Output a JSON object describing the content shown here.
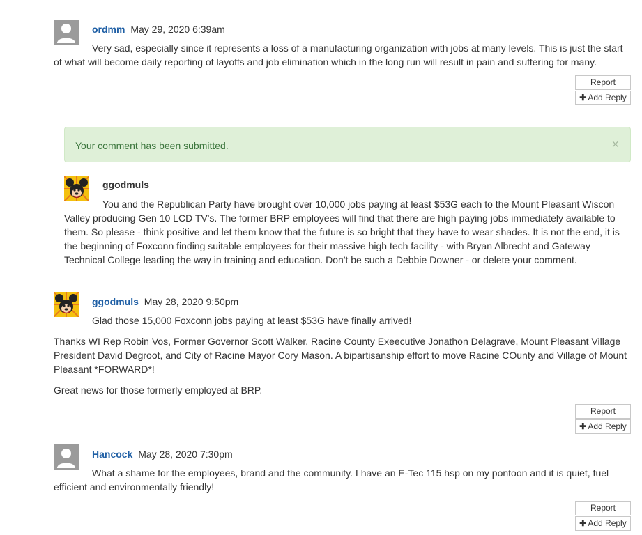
{
  "comments": [
    {
      "author": "ordmm",
      "date": "May 29, 2020 6:39am",
      "avatar": "default-user-icon",
      "paragraphs": [
        "Very sad, especially since it represents a loss of a manufacturing organization with jobs at many levels. This is just the start of what will become daily reporting of layoffs and job elimination which in the long run will result in pain and suffering for many."
      ]
    },
    {
      "author": "ggodmuls",
      "date": "May 28, 2020 9:50pm",
      "avatar": "mickey-mouse-icon",
      "paragraphs": [
        "Glad those 15,000 Foxconn jobs paying at least $53G have finally arrived!",
        "Thanks WI Rep Robin Vos, Former Governor Scott Walker, Racine County Exeecutive Jonathon Delagrave, Mount Pleasant Village President David Degroot, and City of Racine Mayor Cory Mason. A bipartisanship effort to move Racine COunty and Village of Mount Pleasant *FORWARD*!",
        "Great news for those formerly employed at BRP."
      ]
    },
    {
      "author": "Hancock",
      "date": "May 28, 2020 7:30pm",
      "avatar": "default-user-icon",
      "paragraphs": [
        "What a shame for the employees, brand and the community. I have an E-Tec 115 hsp on my pontoon and it is quiet, fuel efficient and environmentally friendly!"
      ]
    }
  ],
  "reply": {
    "author": "ggodmuls",
    "avatar": "mickey-mouse-icon",
    "text": "You and the Republican Party have brought over 10,000 jobs paying at least $53G each to the Mount Pleasant Wiscon Valley producing Gen 10 LCD TV's. The former BRP employees will find that there are high paying jobs immediately available to them. So please - think positive and let them know that the future is so bright that they have to wear shades. It is not the end, it is the beginning of Foxconn finding suitable employees for their massive high tech facility - with Bryan Albrecht and Gateway Technical College leading the way in training and education. Don't be such a Debbie Downer - or delete your comment."
  },
  "alert": {
    "message": "Your comment has been submitted.",
    "close_glyph": "×"
  },
  "buttons": {
    "report_label": "Report",
    "add_reply_label": "Add Reply",
    "add_reply_icon": "plus-icon"
  },
  "colors": {
    "author_link": "#1f5fa5",
    "alert_bg": "#dff0d8",
    "alert_text": "#3c763d"
  }
}
